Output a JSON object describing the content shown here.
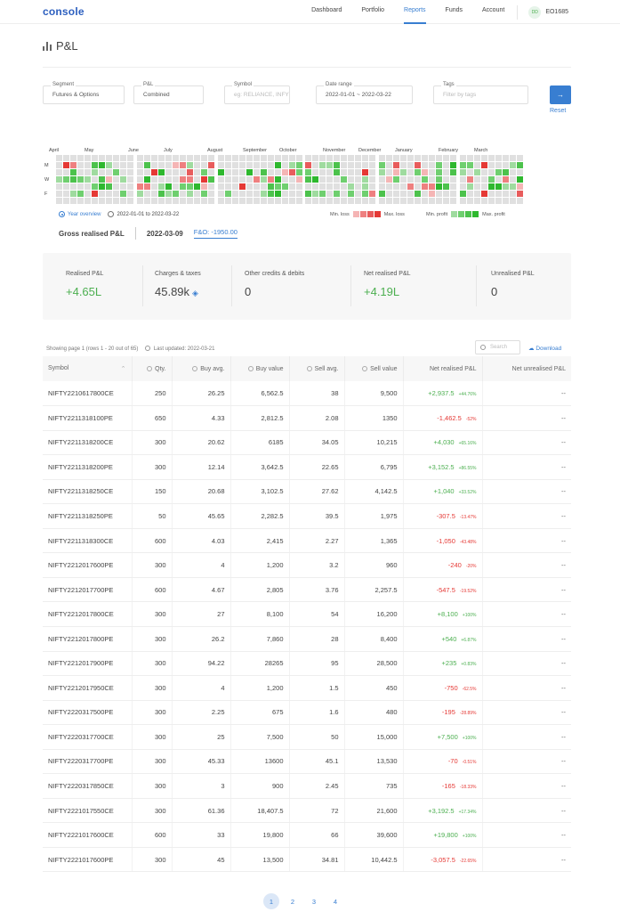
{
  "header": {
    "logo": "console",
    "nav": [
      "Dashboard",
      "Portfolio",
      "Reports",
      "Funds",
      "Account"
    ],
    "active_nav": "Reports",
    "avatar_initials": "DD",
    "user_id": "EO1685"
  },
  "page": {
    "title": "P&L"
  },
  "filters": {
    "segment": {
      "label": "Segment",
      "value": "Futures & Options"
    },
    "pnl": {
      "label": "P&L",
      "value": "Combined"
    },
    "symbol": {
      "label": "Symbol",
      "placeholder": "eg: RELIANCE, INFY"
    },
    "date_range": {
      "label": "Date range",
      "value": "2022-01-01 ~ 2022-03-22"
    },
    "tags": {
      "label": "Tags",
      "placeholder": "Filter by tags"
    },
    "go_icon": "arrow-right-icon",
    "reset": "Reset"
  },
  "heatmap": {
    "months": [
      "April",
      "May",
      "June",
      "July",
      "August",
      "September",
      "October",
      "November",
      "December",
      "January",
      "February",
      "March"
    ],
    "day_labels": [
      "M",
      "W",
      "F"
    ],
    "view_options": [
      "Year overview",
      "2022-01-01 to 2022-03-22"
    ],
    "selected_view": "Year overview",
    "legend": {
      "min_loss": "Min. loss",
      "max_loss": "Max. loss",
      "min_profit": "Min. profit",
      "max_profit": "Max. profit"
    },
    "colors": {
      "empty": "#e0e0e0",
      "loss": [
        "#f5b5b5",
        "#ee8080",
        "#e85c5c",
        "#e53935"
      ],
      "profit": [
        "#9fdb9f",
        "#6fcf6f",
        "#4cc24c",
        "#2eb82e"
      ]
    }
  },
  "gross": {
    "label": "Gross realised P&L",
    "date": "2022-03-09",
    "fo": "F&O: -1950.00"
  },
  "summary": {
    "realised": {
      "label": "Realised P&L",
      "value": "+4.65L"
    },
    "charges": {
      "label": "Charges & taxes",
      "value": "45.89k"
    },
    "other": {
      "label": "Other credits & debits",
      "value": "0"
    },
    "net_realised": {
      "label": "Net realised P&L",
      "value": "+4.19L"
    },
    "unrealised": {
      "label": "Unrealised P&L",
      "value": "0"
    }
  },
  "table_meta": {
    "showing": "Showing page 1 (rows 1 - 20 out of 65)",
    "updated": "Last updated: 2022-03-21",
    "search_placeholder": "Search",
    "download": "Download"
  },
  "table": {
    "columns": [
      "Symbol",
      "Qty.",
      "Buy avg.",
      "Buy value",
      "Sell avg.",
      "Sell value",
      "Net realised P&L",
      "Net unrealised P&L"
    ],
    "rows": [
      {
        "symbol": "NIFTY2210617800CE",
        "qty": "250",
        "buy_avg": "26.25",
        "buy_value": "6,562.5",
        "sell_avg": "38",
        "sell_value": "9,500",
        "pnl": "+2,937.5",
        "pct": "+44.76%",
        "unreal": "--"
      },
      {
        "symbol": "NIFTY2211318100PE",
        "qty": "650",
        "buy_avg": "4.33",
        "buy_value": "2,812.5",
        "sell_avg": "2.08",
        "sell_value": "1350",
        "pnl": "-1,462.5",
        "pct": "-52%",
        "unreal": "--"
      },
      {
        "symbol": "NIFTY2211318200CE",
        "qty": "300",
        "buy_avg": "20.62",
        "buy_value": "6185",
        "sell_avg": "34.05",
        "sell_value": "10,215",
        "pnl": "+4,030",
        "pct": "+65.16%",
        "unreal": "--"
      },
      {
        "symbol": "NIFTY2211318200PE",
        "qty": "300",
        "buy_avg": "12.14",
        "buy_value": "3,642.5",
        "sell_avg": "22.65",
        "sell_value": "6,795",
        "pnl": "+3,152.5",
        "pct": "+86.55%",
        "unreal": "--"
      },
      {
        "symbol": "NIFTY2211318250CE",
        "qty": "150",
        "buy_avg": "20.68",
        "buy_value": "3,102.5",
        "sell_avg": "27.62",
        "sell_value": "4,142.5",
        "pnl": "+1,040",
        "pct": "+33.52%",
        "unreal": "--"
      },
      {
        "symbol": "NIFTY2211318250PE",
        "qty": "50",
        "buy_avg": "45.65",
        "buy_value": "2,282.5",
        "sell_avg": "39.5",
        "sell_value": "1,975",
        "pnl": "-307.5",
        "pct": "-13.47%",
        "unreal": "--"
      },
      {
        "symbol": "NIFTY2211318300CE",
        "qty": "600",
        "buy_avg": "4.03",
        "buy_value": "2,415",
        "sell_avg": "2.27",
        "sell_value": "1,365",
        "pnl": "-1,050",
        "pct": "-43.48%",
        "unreal": "--"
      },
      {
        "symbol": "NIFTY2212017600PE",
        "qty": "300",
        "buy_avg": "4",
        "buy_value": "1,200",
        "sell_avg": "3.2",
        "sell_value": "960",
        "pnl": "-240",
        "pct": "-20%",
        "unreal": "--"
      },
      {
        "symbol": "NIFTY2212017700PE",
        "qty": "600",
        "buy_avg": "4.67",
        "buy_value": "2,805",
        "sell_avg": "3.76",
        "sell_value": "2,257.5",
        "pnl": "-547.5",
        "pct": "-19.52%",
        "unreal": "--"
      },
      {
        "symbol": "NIFTY2212017800CE",
        "qty": "300",
        "buy_avg": "27",
        "buy_value": "8,100",
        "sell_avg": "54",
        "sell_value": "16,200",
        "pnl": "+8,100",
        "pct": "+100%",
        "unreal": "--"
      },
      {
        "symbol": "NIFTY2212017800PE",
        "qty": "300",
        "buy_avg": "26.2",
        "buy_value": "7,860",
        "sell_avg": "28",
        "sell_value": "8,400",
        "pnl": "+540",
        "pct": "+6.87%",
        "unreal": "--"
      },
      {
        "symbol": "NIFTY2212017900PE",
        "qty": "300",
        "buy_avg": "94.22",
        "buy_value": "28265",
        "sell_avg": "95",
        "sell_value": "28,500",
        "pnl": "+235",
        "pct": "+0.83%",
        "unreal": "--"
      },
      {
        "symbol": "NIFTY2212017950CE",
        "qty": "300",
        "buy_avg": "4",
        "buy_value": "1,200",
        "sell_avg": "1.5",
        "sell_value": "450",
        "pnl": "-750",
        "pct": "-62.5%",
        "unreal": "--"
      },
      {
        "symbol": "NIFTY2220317500PE",
        "qty": "300",
        "buy_avg": "2.25",
        "buy_value": "675",
        "sell_avg": "1.6",
        "sell_value": "480",
        "pnl": "-195",
        "pct": "-28.89%",
        "unreal": "--"
      },
      {
        "symbol": "NIFTY2220317700CE",
        "qty": "300",
        "buy_avg": "25",
        "buy_value": "7,500",
        "sell_avg": "50",
        "sell_value": "15,000",
        "pnl": "+7,500",
        "pct": "+100%",
        "unreal": "--"
      },
      {
        "symbol": "NIFTY2220317700PE",
        "qty": "300",
        "buy_avg": "45.33",
        "buy_value": "13600",
        "sell_avg": "45.1",
        "sell_value": "13,530",
        "pnl": "-70",
        "pct": "-0.51%",
        "unreal": "--"
      },
      {
        "symbol": "NIFTY2220317850CE",
        "qty": "300",
        "buy_avg": "3",
        "buy_value": "900",
        "sell_avg": "2.45",
        "sell_value": "735",
        "pnl": "-165",
        "pct": "-18.33%",
        "unreal": "--"
      },
      {
        "symbol": "NIFTY2221017550CE",
        "qty": "300",
        "buy_avg": "61.36",
        "buy_value": "18,407.5",
        "sell_avg": "72",
        "sell_value": "21,600",
        "pnl": "+3,192.5",
        "pct": "+17.34%",
        "unreal": "--"
      },
      {
        "symbol": "NIFTY2221017600CE",
        "qty": "600",
        "buy_avg": "33",
        "buy_value": "19,800",
        "sell_avg": "66",
        "sell_value": "39,600",
        "pnl": "+19,800",
        "pct": "+100%",
        "unreal": "--"
      },
      {
        "symbol": "NIFTY2221017600PE",
        "qty": "300",
        "buy_avg": "45",
        "buy_value": "13,500",
        "sell_avg": "34.81",
        "sell_value": "10,442.5",
        "pnl": "-3,057.5",
        "pct": "-22.65%",
        "unreal": "--"
      }
    ]
  },
  "pagination": {
    "pages": [
      "1",
      "2",
      "3",
      "4"
    ],
    "current": "1"
  }
}
